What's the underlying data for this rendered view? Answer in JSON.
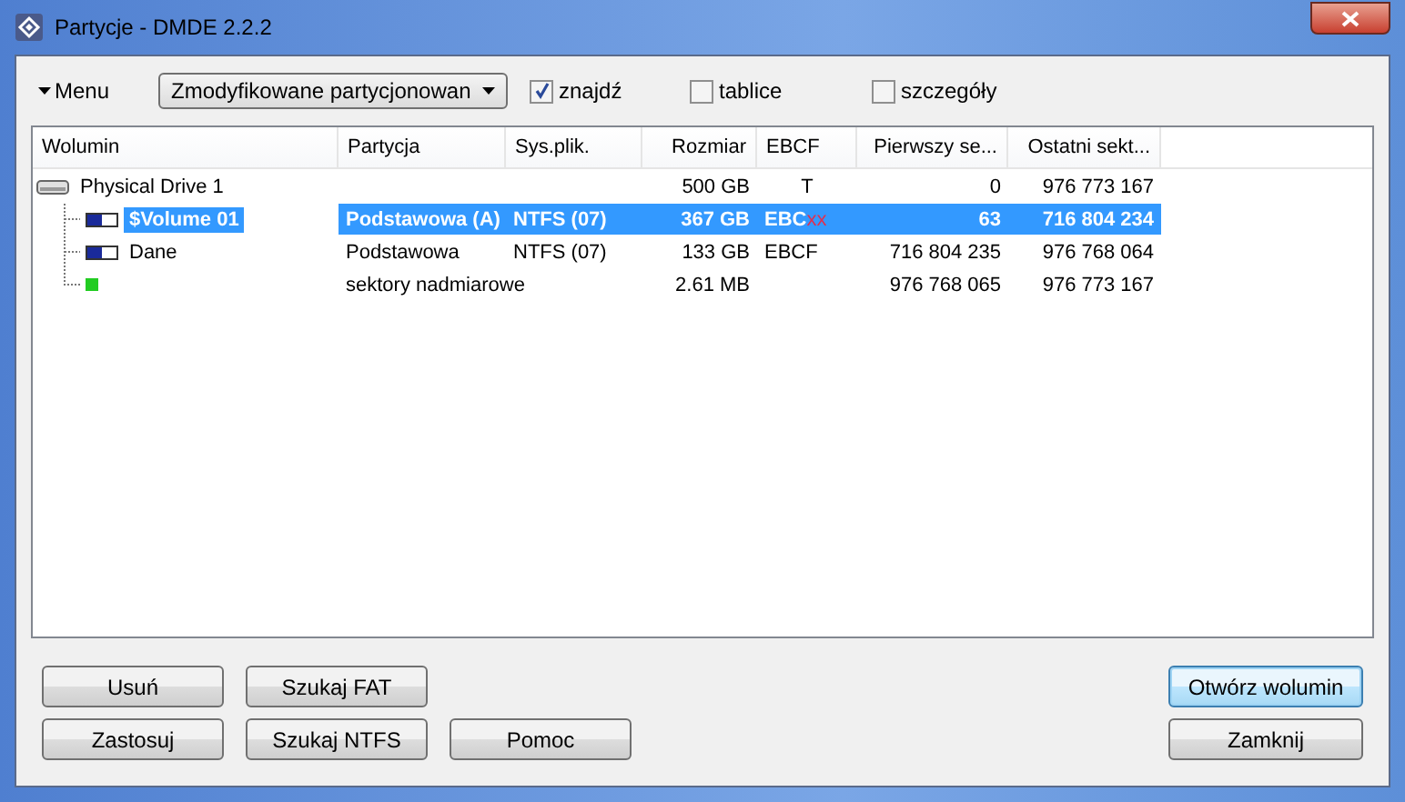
{
  "window": {
    "title": "Partycje - DMDE 2.2.2"
  },
  "toolbar": {
    "menu": "Menu",
    "mode": "Zmodyfikowane partycjonowan",
    "options": [
      {
        "label": "znajdź",
        "checked": true
      },
      {
        "label": "tablice",
        "checked": false
      },
      {
        "label": "szczegóły",
        "checked": false
      }
    ]
  },
  "table": {
    "columns": [
      "Wolumin",
      "Partycja",
      "Sys.plik.",
      "Rozmiar",
      "EBCF",
      "Pierwszy se...",
      "Ostatni sekt..."
    ],
    "rows": [
      {
        "kind": "drive",
        "name": "Physical Drive 1",
        "size": "500 GB",
        "ebcf": "T",
        "first": "0",
        "last": "976 773 167",
        "selected": false,
        "children": [
          {
            "kind": "volume",
            "name": "$Volume 01",
            "partition": "Podstawowa (A)",
            "fs": "NTFS (07)",
            "size": "367 GB",
            "ebcf": "EBC",
            "ebcf_flag": "xx",
            "first": "63",
            "last": "716 804 234",
            "selected": true
          },
          {
            "kind": "volume",
            "name": "Dane",
            "partition": "Podstawowa",
            "fs": "NTFS (07)",
            "size": "133 GB",
            "ebcf": "EBCF",
            "first": "716 804 235",
            "last": "976 768 064",
            "selected": false
          },
          {
            "kind": "free",
            "partition": "sektory nadmiarowe",
            "size": "2.61 MB",
            "first": "976 768 065",
            "last": "976 773 167",
            "selected": false
          }
        ]
      }
    ]
  },
  "buttons_left": [
    [
      "Usuń",
      "Szukaj FAT"
    ],
    [
      "Zastosuj",
      "Szukaj NTFS",
      "Pomoc"
    ]
  ],
  "buttons_right": [
    {
      "label": "Otwórz wolumin",
      "default": true
    },
    {
      "label": "Zamknij",
      "default": false
    }
  ]
}
